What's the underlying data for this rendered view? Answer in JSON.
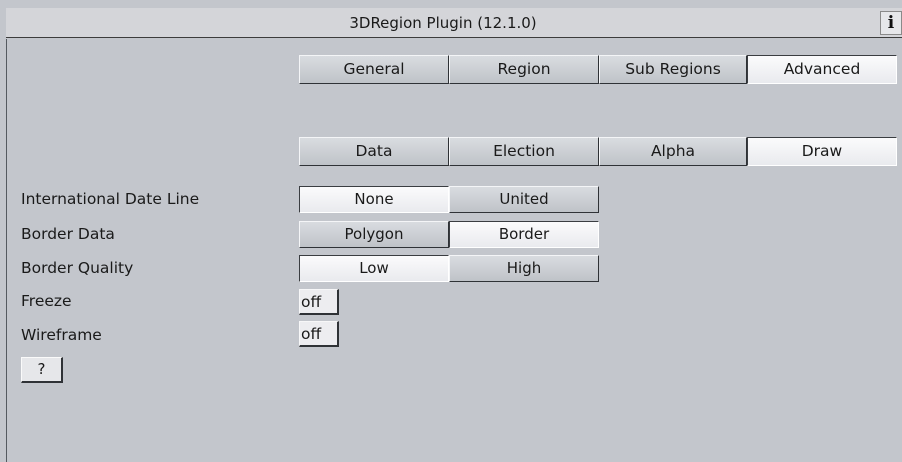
{
  "window": {
    "title": "3DRegion Plugin (12.1.0)",
    "info_label": "i"
  },
  "main_tabs": [
    {
      "label": "General",
      "active": false
    },
    {
      "label": "Region",
      "active": false
    },
    {
      "label": "Sub Regions",
      "active": false
    },
    {
      "label": "Advanced",
      "active": true
    }
  ],
  "sub_tabs": [
    {
      "label": "Data",
      "active": false
    },
    {
      "label": "Election",
      "active": false
    },
    {
      "label": "Alpha",
      "active": false
    },
    {
      "label": "Draw",
      "active": true
    }
  ],
  "settings": {
    "international_date_line": {
      "label": "International Date Line",
      "options": [
        "None",
        "United"
      ],
      "selected": "None"
    },
    "border_data": {
      "label": "Border Data",
      "options": [
        "Polygon",
        "Border"
      ],
      "selected": "Border"
    },
    "border_quality": {
      "label": "Border Quality",
      "options": [
        "Low",
        "High"
      ],
      "selected": "Low"
    },
    "freeze": {
      "label": "Freeze",
      "value": "off"
    },
    "wireframe": {
      "label": "Wireframe",
      "value": "off"
    }
  },
  "help_label": "?"
}
